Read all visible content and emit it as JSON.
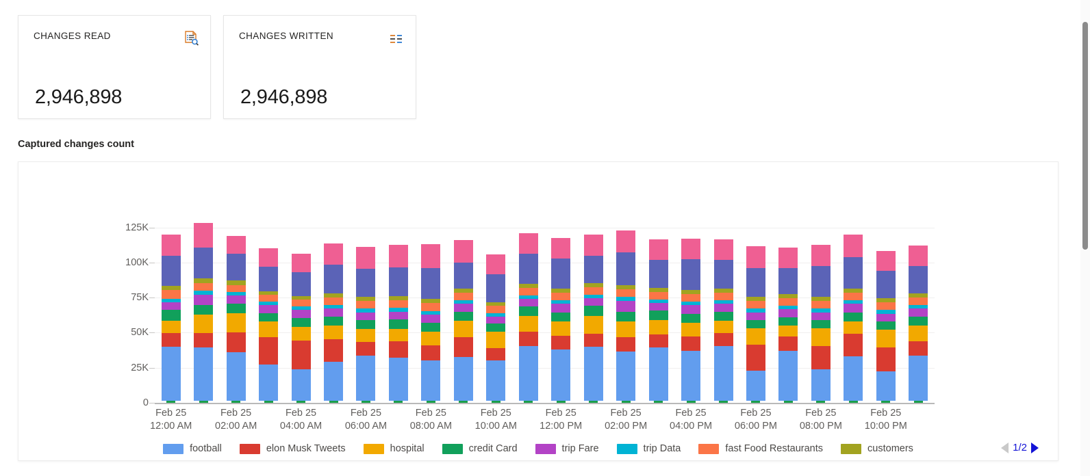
{
  "kpis": [
    {
      "title": "CHANGES READ",
      "value": "2,946,898",
      "icon": "document-search-icon"
    },
    {
      "title": "CHANGES WRITTEN",
      "value": "2,946,898",
      "icon": "list-rows-icon"
    }
  ],
  "section": {
    "title": "Captured changes count"
  },
  "pager": {
    "label": "1/2",
    "prev_icon": "triangle-left-icon",
    "next_icon": "triangle-right-icon"
  },
  "scrollbar": {
    "name": "vertical-scrollbar"
  },
  "chart_data": {
    "type": "bar",
    "stacked": true,
    "title": "Captured changes count",
    "xlabel": "",
    "ylabel": "",
    "ylim": [
      0,
      137500
    ],
    "yticks": [
      0,
      25000,
      50000,
      75000,
      100000,
      125000
    ],
    "ytick_labels": [
      "0",
      "25K",
      "50K",
      "75K",
      "100K",
      "125K"
    ],
    "grid": true,
    "legend_position": "bottom",
    "legend_page": "1/2",
    "categories": [
      "Feb 25\n12:00 AM",
      "Feb 25\n01:00 AM",
      "Feb 25\n02:00 AM",
      "Feb 25\n03:00 AM",
      "Feb 25\n04:00 AM",
      "Feb 25\n05:00 AM",
      "Feb 25\n06:00 AM",
      "Feb 25\n07:00 AM",
      "Feb 25\n08:00 AM",
      "Feb 25\n09:00 AM",
      "Feb 25\n10:00 AM",
      "Feb 25\n11:00 AM",
      "Feb 25\n12:00 PM",
      "Feb 25\n01:00 PM",
      "Feb 25\n02:00 PM",
      "Feb 25\n03:00 PM",
      "Feb 25\n04:00 PM",
      "Feb 25\n05:00 PM",
      "Feb 25\n06:00 PM",
      "Feb 25\n07:00 PM",
      "Feb 25\n08:00 PM",
      "Feb 25\n09:00 PM",
      "Feb 25\n10:00 PM",
      "Feb 25\n11:00 PM"
    ],
    "xtick_labels": [
      {
        "index": 0,
        "line1": "Feb 25",
        "line2": "12:00 AM"
      },
      {
        "index": 2,
        "line1": "Feb 25",
        "line2": "02:00 AM"
      },
      {
        "index": 4,
        "line1": "Feb 25",
        "line2": "04:00 AM"
      },
      {
        "index": 6,
        "line1": "Feb 25",
        "line2": "06:00 AM"
      },
      {
        "index": 8,
        "line1": "Feb 25",
        "line2": "08:00 AM"
      },
      {
        "index": 10,
        "line1": "Feb 25",
        "line2": "10:00 AM"
      },
      {
        "index": 12,
        "line1": "Feb 25",
        "line2": "12:00 PM"
      },
      {
        "index": 14,
        "line1": "Feb 25",
        "line2": "02:00 PM"
      },
      {
        "index": 16,
        "line1": "Feb 25",
        "line2": "04:00 PM"
      },
      {
        "index": 18,
        "line1": "Feb 25",
        "line2": "06:00 PM"
      },
      {
        "index": 20,
        "line1": "Feb 25",
        "line2": "08:00 PM"
      },
      {
        "index": 22,
        "line1": "Feb 25",
        "line2": "10:00 PM"
      }
    ],
    "series": [
      {
        "name": "marker",
        "color": "#1a9e4b",
        "in_legend": false,
        "values": [
          1600,
          1600,
          1600,
          1600,
          1600,
          1600,
          1600,
          1600,
          1600,
          1600,
          1600,
          1600,
          1600,
          1600,
          1600,
          1600,
          1600,
          1600,
          1600,
          1600,
          1600,
          1600,
          1600,
          1600
        ]
      },
      {
        "name": "football",
        "color": "#629dee",
        "in_legend": true,
        "values": [
          38500,
          37800,
          34500,
          25500,
          22500,
          27500,
          32000,
          30500,
          28500,
          31000,
          28500,
          39000,
          36500,
          38500,
          35000,
          38000,
          35500,
          39000,
          21500,
          35500,
          22500,
          31500,
          21000,
          32000
        ]
      },
      {
        "name": "elon Musk Tweets",
        "color": "#d93b30",
        "in_legend": true,
        "values": [
          9500,
          10500,
          14000,
          19500,
          20500,
          16500,
          10000,
          12000,
          11000,
          14000,
          9000,
          10000,
          9500,
          9000,
          10000,
          9000,
          10000,
          9000,
          18500,
          10000,
          16500,
          16000,
          17000,
          10500
        ]
      },
      {
        "name": "hospital",
        "color": "#f2a900",
        "in_legend": true,
        "values": [
          9000,
          13000,
          14000,
          11500,
          9500,
          9500,
          9000,
          8500,
          9500,
          12000,
          11500,
          11500,
          10500,
          13000,
          11500,
          10500,
          10000,
          9000,
          11500,
          8000,
          12500,
          9000,
          12500,
          11000
        ]
      },
      {
        "name": "credit Card",
        "color": "#11a05b",
        "in_legend": true,
        "values": [
          7500,
          7000,
          6500,
          6000,
          6500,
          6500,
          6500,
          7000,
          6500,
          6500,
          6000,
          6500,
          6500,
          7000,
          7000,
          6500,
          6500,
          6500,
          6000,
          6000,
          6000,
          6500,
          6000,
          6500
        ]
      },
      {
        "name": "trip Fare",
        "color": "#b343c6",
        "in_legend": true,
        "values": [
          5500,
          7000,
          6000,
          5500,
          5500,
          5500,
          5500,
          5500,
          6000,
          5500,
          5000,
          5500,
          6000,
          5500,
          7500,
          5500,
          6000,
          5500,
          5500,
          5500,
          5500,
          6000,
          5500,
          5500
        ]
      },
      {
        "name": "trip Data",
        "color": "#00b3d4",
        "in_legend": true,
        "values": [
          2500,
          3000,
          2500,
          2500,
          2500,
          2500,
          2500,
          2500,
          2500,
          2500,
          2500,
          2500,
          2500,
          2500,
          3000,
          2500,
          2500,
          2500,
          2500,
          2500,
          2500,
          2500,
          2500,
          2500
        ]
      },
      {
        "name": "fast Food Restaurants",
        "color": "#fb7547",
        "in_legend": true,
        "values": [
          6500,
          5500,
          5000,
          5000,
          5000,
          5500,
          5500,
          5500,
          5500,
          5500,
          5000,
          5500,
          5500,
          5500,
          5500,
          5500,
          5500,
          5500,
          5500,
          5500,
          5500,
          5500,
          5500,
          5500
        ]
      },
      {
        "name": "customers",
        "color": "#a2a320",
        "in_legend": true,
        "values": [
          3000,
          3500,
          3000,
          2500,
          2500,
          3000,
          3000,
          3000,
          3000,
          3000,
          2500,
          3000,
          3000,
          3000,
          3000,
          3000,
          3000,
          3000,
          3000,
          3000,
          3000,
          3000,
          3000,
          3000
        ]
      },
      {
        "name": "series-9",
        "color": "#5b63b7",
        "in_legend": false,
        "values": [
          21500,
          22000,
          19000,
          17500,
          17000,
          20500,
          20000,
          20500,
          22000,
          18500,
          20000,
          21000,
          21500,
          19500,
          23000,
          20000,
          22000,
          20500,
          20500,
          18500,
          22000,
          22500,
          19500,
          19500
        ]
      },
      {
        "name": "series-10",
        "color": "#ef5f93",
        "in_legend": false,
        "values": [
          15000,
          17500,
          13000,
          13000,
          13000,
          15000,
          15500,
          16000,
          17000,
          16000,
          14000,
          15000,
          14500,
          15000,
          16000,
          14500,
          14500,
          14500,
          15500,
          14500,
          15000,
          16000,
          14000,
          14500
        ]
      }
    ],
    "legend": [
      {
        "label": "football",
        "color": "#629dee"
      },
      {
        "label": "elon Musk Tweets",
        "color": "#d93b30"
      },
      {
        "label": "hospital",
        "color": "#f2a900"
      },
      {
        "label": "credit Card",
        "color": "#11a05b"
      },
      {
        "label": "trip Fare",
        "color": "#b343c6"
      },
      {
        "label": "trip Data",
        "color": "#00b3d4"
      },
      {
        "label": "fast Food Restaurants",
        "color": "#fb7547"
      },
      {
        "label": "customers",
        "color": "#a2a320"
      }
    ]
  }
}
